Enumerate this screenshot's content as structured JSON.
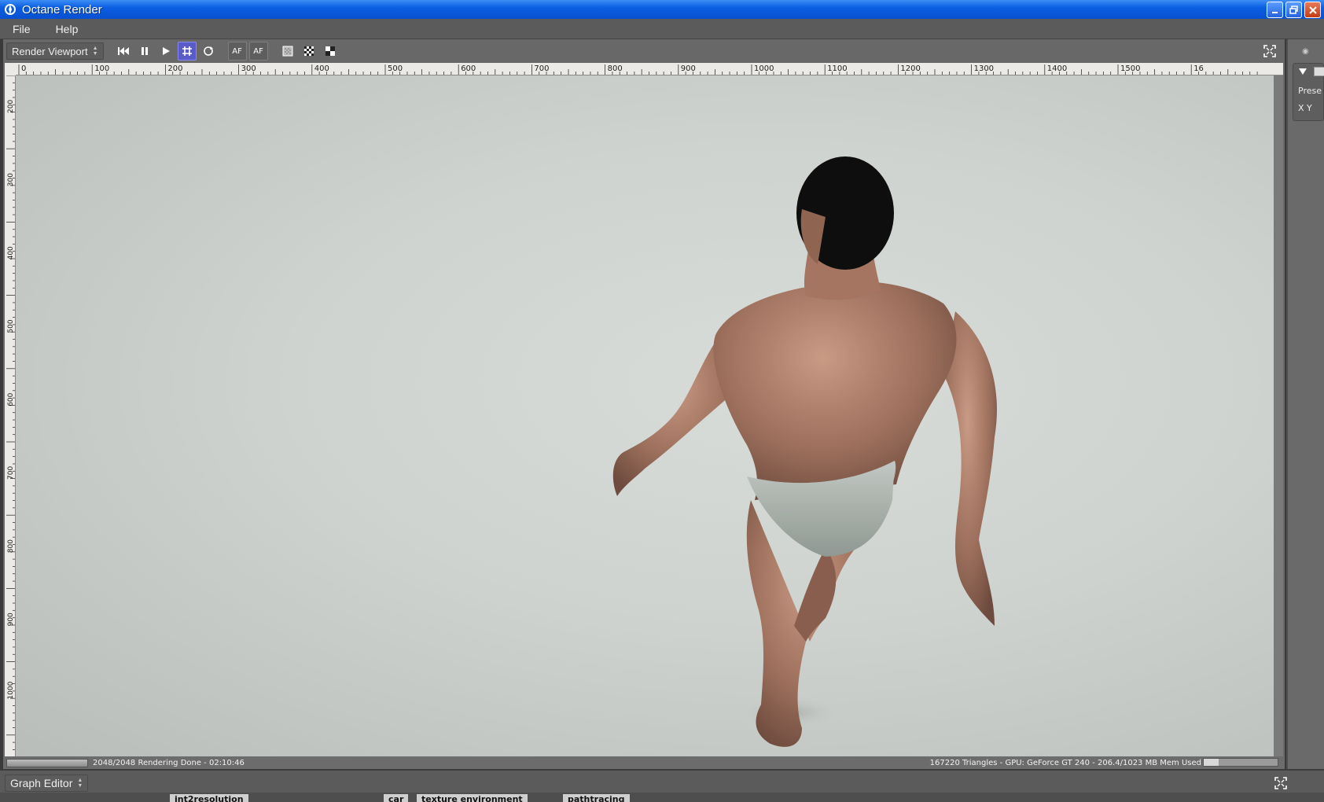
{
  "window": {
    "title": "Octane Render"
  },
  "menu": {
    "items": [
      "File",
      "Help"
    ]
  },
  "toolbar": {
    "view_select": "Render Viewport",
    "buttons": [
      {
        "name": "restart-render-icon",
        "label": ""
      },
      {
        "name": "pause-icon",
        "label": ""
      },
      {
        "name": "play-icon",
        "label": ""
      },
      {
        "name": "grid-icon",
        "label": "",
        "active": true
      },
      {
        "name": "refresh-icon",
        "label": ""
      },
      {
        "name": "autofocus-button",
        "label": "AF"
      },
      {
        "name": "autofocus-picker-button",
        "label": "AF"
      },
      {
        "name": "alpha-background-icon",
        "label": ""
      },
      {
        "name": "checker-icon",
        "label": ""
      },
      {
        "name": "region-icon",
        "label": ""
      }
    ]
  },
  "ruler": {
    "horizontal_labels": [
      "0",
      "100",
      "200",
      "300",
      "400",
      "500",
      "600",
      "700",
      "800",
      "900",
      "1000",
      "1100",
      "1200",
      "1300",
      "1400",
      "1500",
      "16"
    ],
    "vertical_labels": [
      "200",
      "300",
      "400",
      "500",
      "600",
      "700",
      "800",
      "900",
      "1000"
    ]
  },
  "status": {
    "progress": 1.0,
    "left_text": "2048/2048 Rendering Done - 02:10:46",
    "right_text": "167220 Triangles - GPU: GeForce GT 240 - 206.4/1023 MB Mem Used",
    "mem_fraction": 0.2
  },
  "side_panel": {
    "label": "Prese",
    "xy_label": "X Y"
  },
  "graph_editor": {
    "title": "Graph Editor",
    "nodes": [
      "int2resolution",
      "car",
      "texture environment",
      "pathtracing"
    ]
  },
  "colors": {
    "titlebar": "#0a5ee0",
    "active_button": "#5a5ac8",
    "background_render": "#cfd3cf"
  }
}
